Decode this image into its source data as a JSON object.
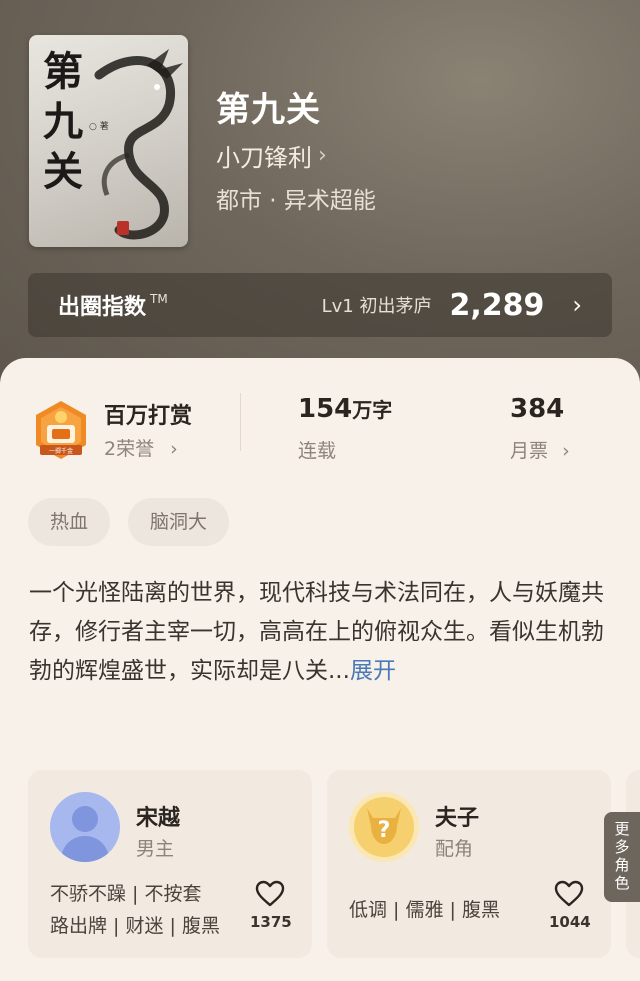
{
  "book": {
    "cover_title_chars": [
      "第",
      "九",
      "关"
    ],
    "cover_author_mark": "○ 著",
    "title": "第九关",
    "author": "小刀锋利",
    "genre": "都市 · 异术超能"
  },
  "index": {
    "label": "出圈指数",
    "tm": "TM",
    "level": "Lv1 初出茅庐",
    "value": "2,289"
  },
  "stats": {
    "honor_title": "百万打赏",
    "honor_sub": "2荣誉",
    "badge_text": "一掷千金",
    "words_value": "154",
    "words_unit": "万字",
    "words_sub": "连载",
    "votes_value": "384",
    "votes_sub": "月票"
  },
  "tags": [
    "热血",
    "脑洞大"
  ],
  "description": {
    "text": "一个光怪陆离的世界，现代科技与术法同在，人与妖魔共存，修行者主宰一切，高高在上的俯视众生。看似生机勃勃的辉煌盛世，实际却是八关...",
    "expand": "展开"
  },
  "characters": [
    {
      "name": "宋越",
      "role": "男主",
      "traits_line1": "不骄不躁 | 不按套",
      "traits_line2": "路出牌 | 财迷 | 腹黑",
      "likes": "1375"
    },
    {
      "name": "夫子",
      "role": "配角",
      "traits_line1": "低调 | 儒雅 | 腹黑",
      "traits_line2": "",
      "likes": "1044"
    }
  ],
  "more_roles": [
    "更",
    "多",
    "角",
    "色"
  ],
  "colors": {
    "card_bg": "#f8f1ea",
    "link": "#4a79b8",
    "badge_orange": "#f08a24"
  }
}
